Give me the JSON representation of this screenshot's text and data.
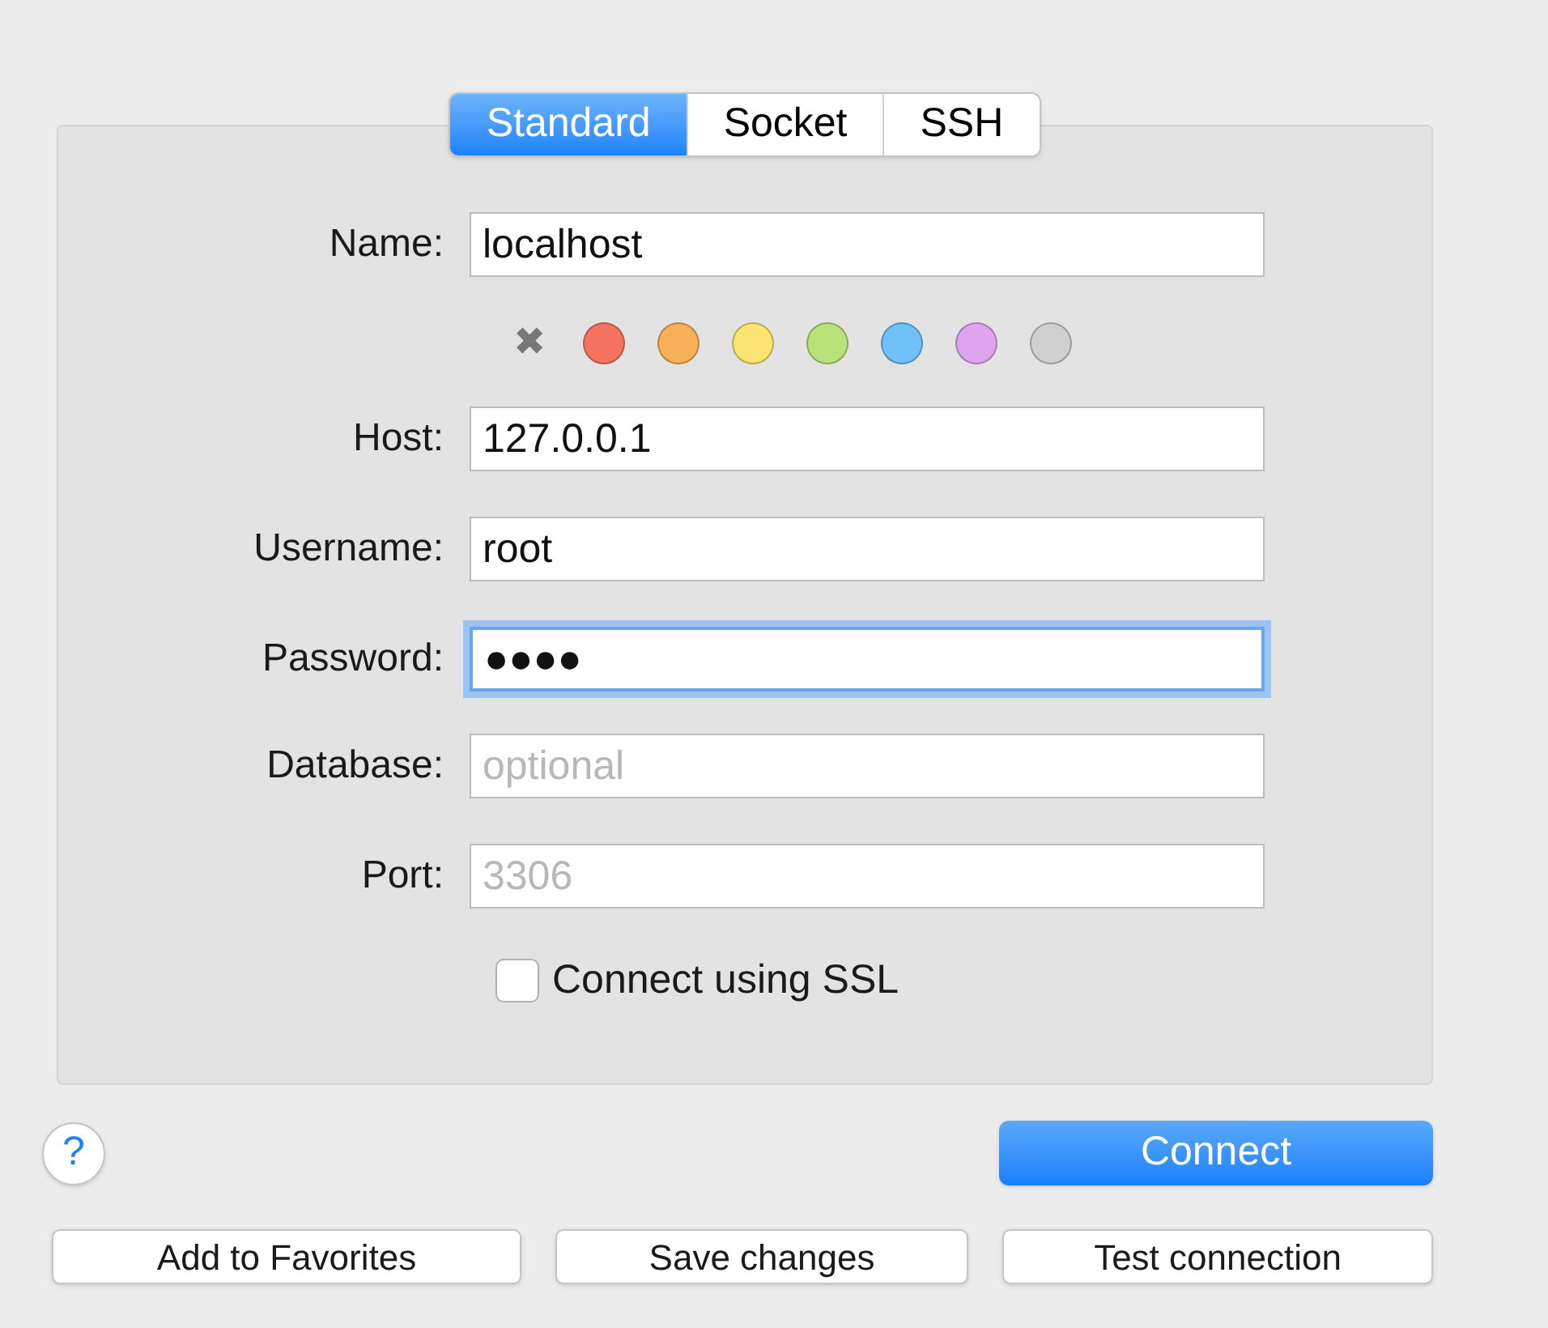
{
  "tabs": [
    {
      "label": "Standard",
      "selected": true
    },
    {
      "label": "Socket",
      "selected": false
    },
    {
      "label": "SSH",
      "selected": false
    }
  ],
  "name_field": {
    "label": "Name:",
    "value": "localhost",
    "focused": false
  },
  "color_options": [
    {
      "kind": "none",
      "label": "✖",
      "selected": false
    },
    {
      "kind": "dot",
      "color": "#f4735f",
      "selected": false
    },
    {
      "kind": "dot",
      "color": "#f8b15a",
      "selected": false
    },
    {
      "kind": "dot",
      "color": "#fbe46f",
      "selected": false
    },
    {
      "kind": "dot",
      "color": "#b9e27b",
      "selected": false
    },
    {
      "kind": "dot",
      "color": "#6fc1f6",
      "selected": false
    },
    {
      "kind": "dot",
      "color": "#dfa4ef",
      "selected": false
    },
    {
      "kind": "dot",
      "color": "#d0d0d0",
      "selected": false
    }
  ],
  "fields": [
    {
      "label": "Host:",
      "value": "127.0.0.1",
      "focused": false
    },
    {
      "label": "Username:",
      "value": "root",
      "focused": false
    },
    {
      "label": "Password:",
      "value": "●●●●",
      "focused": true
    },
    {
      "label": "Database:",
      "placeholder": "optional",
      "focused": false
    },
    {
      "label": "Port:",
      "placeholder": "3306",
      "focused": false
    }
  ],
  "ssl_checkbox": {
    "label": "Connect using SSL",
    "checked": false
  },
  "help_button": {
    "label": "?"
  },
  "connect_button": {
    "label": "Connect"
  },
  "bottom_buttons": [
    "Add to Favorites",
    "Save changes",
    "Test connection"
  ]
}
